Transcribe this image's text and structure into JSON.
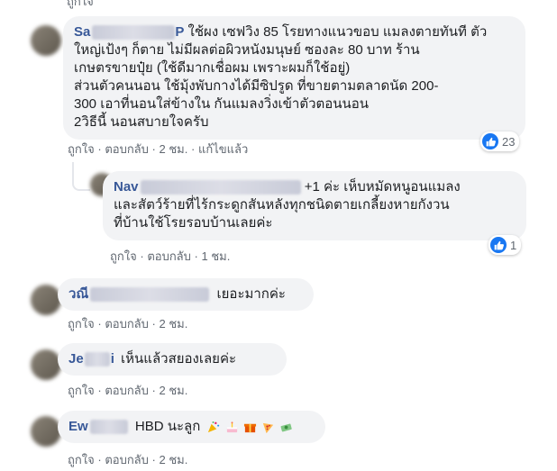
{
  "action_labels": {
    "like": "ถูกใจ",
    "reply": "ตอบกลับ",
    "sep": "·"
  },
  "comments": [
    {
      "name_prefix": "Sa",
      "name_suffix": "P",
      "lines": [
        "ใช้ผง เซฟวิง 85 โรยทางแนวขอบ แมลงตายทันที ตัว",
        "ใหญ่เป้งๆ ก็ตาย ไม่มีผลต่อผิวหนังมนุษย์ ซองละ 80 บาท ร้าน",
        "เกษตรขายปุ๋ย (ใช้ดีมากเชื่อผม เพราะผมก็ใช้อยู่)",
        "ส่วนตัวคนนอน ใช้มุ้งพับกางได้มีซิปรูด ที่ขายตามตลาดนัด 200-",
        "300 เอาที่นอนใส่ข้างใน กันแมลงวิ่งเข้าตัวตอนนอน",
        "2วิธีนี้ นอนสบายใจครับ"
      ],
      "time": "2 ชม.",
      "edited": "แก้ไขแล้ว",
      "reactions": "23"
    },
    {
      "name_prefix": "Nav",
      "text_first": "+1 ค่ะ เห็บหมัดหนูอนแมลง",
      "lines": [
        "และสัตว์ร้ายที่ไร้กระดูกสันหลังทุกชนิดตายเกลี้ยงหายกังวน",
        "ที่บ้านใช้โรยรอบบ้านเลยค่ะ"
      ],
      "time": "1 ชม.",
      "reactions": "1"
    },
    {
      "name_prefix": "วณี",
      "text": "เยอะมากค่ะ",
      "time": "2 ชม."
    },
    {
      "name_prefix": "Je",
      "name_suffix": "i",
      "text": "เห็นแล้วสยองเลยค่ะ",
      "time": "2 ชม."
    },
    {
      "name_prefix": "Ew",
      "text": "HBD นะลูก",
      "emojis": [
        "party-popper-icon",
        "birthday-cake-icon",
        "gift-icon",
        "pizza-icon",
        "money-icon"
      ],
      "time": "2 ชม."
    }
  ],
  "colors": {
    "name": "#385898",
    "bubble": "#f2f3f5",
    "like_blue": "#1877f2",
    "meta": "#606770"
  }
}
